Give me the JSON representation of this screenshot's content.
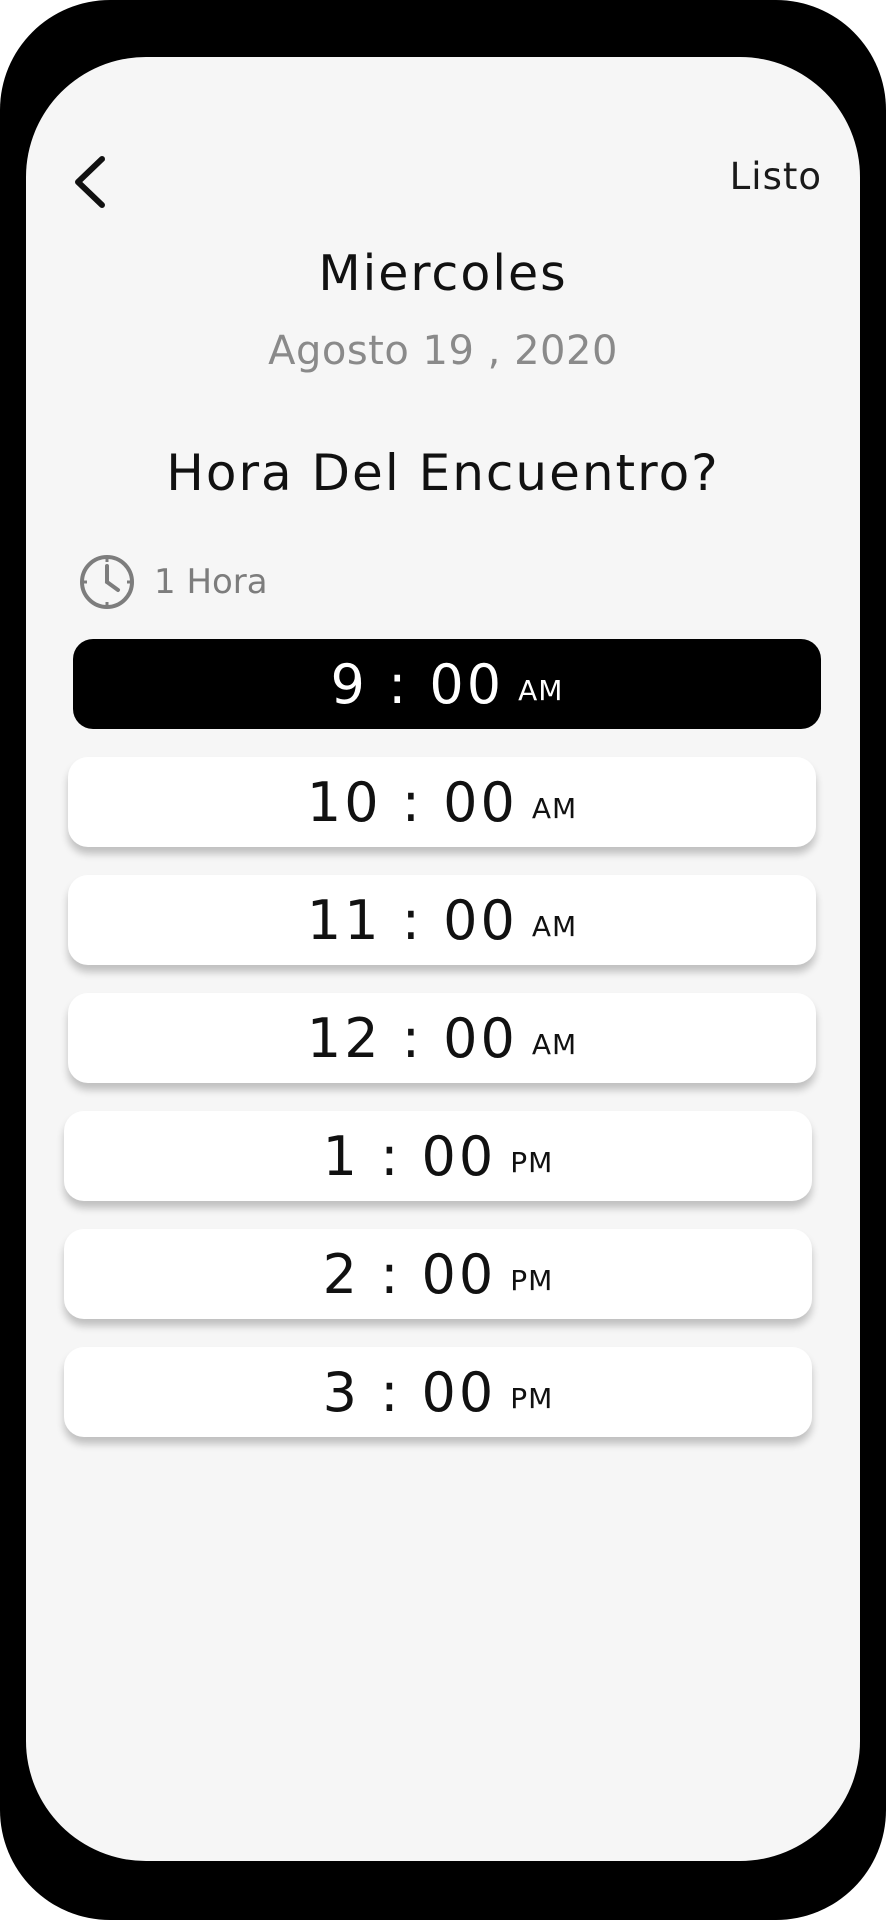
{
  "header": {
    "back_icon": "chevron-left-icon",
    "done_label": "Listo"
  },
  "date": {
    "weekday": "Miercoles",
    "full_date": "Agosto 19 , 2020"
  },
  "question": "Hora Del Encuentro?",
  "duration": {
    "icon": "clock-icon",
    "label": "1 Hora"
  },
  "slots": [
    {
      "time": "9 : 00",
      "period": "AM",
      "selected": true
    },
    {
      "time": "10 : 00",
      "period": "AM",
      "selected": false
    },
    {
      "time": "11 : 00",
      "period": "AM",
      "selected": false
    },
    {
      "time": "12 : 00",
      "period": "AM",
      "selected": false
    },
    {
      "time": "1 : 00",
      "period": "PM",
      "selected": false
    },
    {
      "time": "2 : 00",
      "period": "PM",
      "selected": false
    },
    {
      "time": "3 : 00",
      "period": "PM",
      "selected": false
    }
  ],
  "colors": {
    "selected_bg": "#000000",
    "slot_bg": "#ffffff",
    "screen_bg": "#f6f6f6",
    "muted_text": "#8a8a8a"
  }
}
